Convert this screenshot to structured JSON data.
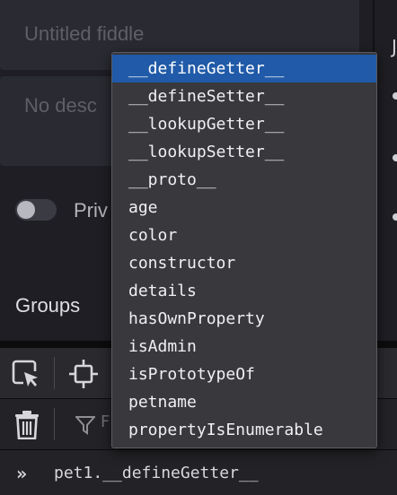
{
  "settings": {
    "title_placeholder": "Untitled fiddle",
    "description_placeholder": "No desc",
    "private_label": "Priv",
    "groups_label": "Groups",
    "right_strip_text": "J"
  },
  "devtools": {
    "filter_placeholder": "F",
    "prompt_glyph": "»",
    "console_input": "pet1.__defineGetter__"
  },
  "autocomplete": {
    "selected_index": 0,
    "items": [
      "__defineGetter__",
      "__defineSetter__",
      "__lookupGetter__",
      "__lookupSetter__",
      "__proto__",
      "age",
      "color",
      "constructor",
      "details",
      "hasOwnProperty",
      "isAdmin",
      "isPrototypeOf",
      "petname",
      "propertyIsEnumerable"
    ]
  },
  "colors": {
    "selection": "#205aa8",
    "popup_bg": "#38383d",
    "panel_bg": "#1e1e24"
  },
  "icons": [
    "element-picker-icon",
    "responsive-design-icon",
    "trash-icon",
    "filter-icon",
    "prompt-chevron-icon"
  ]
}
